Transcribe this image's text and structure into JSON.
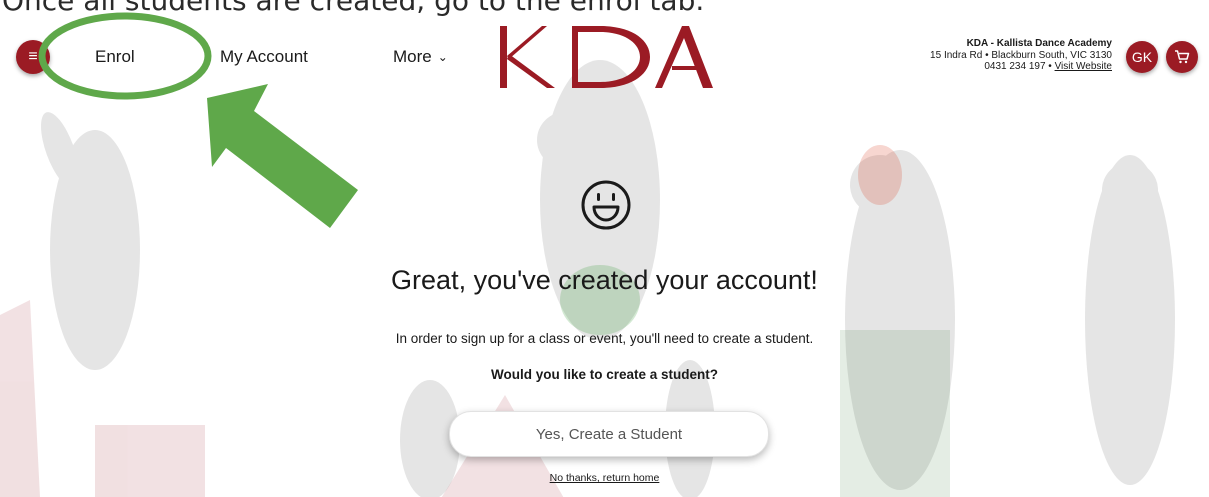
{
  "caption": "Once all students are created, go to the enrol tab.",
  "header": {
    "menu_icon": "hamburger-icon",
    "nav": {
      "enrol": "Enrol",
      "my_account": "My Account",
      "more": "More",
      "more_icon": "chevron-down-icon"
    },
    "logo_text": "KDA",
    "studio": {
      "name": "KDA - Kallista Dance Academy",
      "address": "15 Indra Rd • Blackburn South, VIC 3130",
      "phone": "0431 234 197",
      "separator": " • ",
      "website_link": "Visit Website"
    },
    "avatar_initials": "GK",
    "cart_icon": "cart-icon"
  },
  "main": {
    "icon": "smiley-icon",
    "headline": "Great, you've created your account!",
    "body": "In order to sign up for a class or event, you'll need to create a student.",
    "question": "Would you like to create a student?",
    "primary_button": "Yes, Create a Student",
    "secondary_link": "No thanks, return home"
  },
  "colors": {
    "brand": "#9b1b24",
    "annotation": "#5fa84a"
  }
}
